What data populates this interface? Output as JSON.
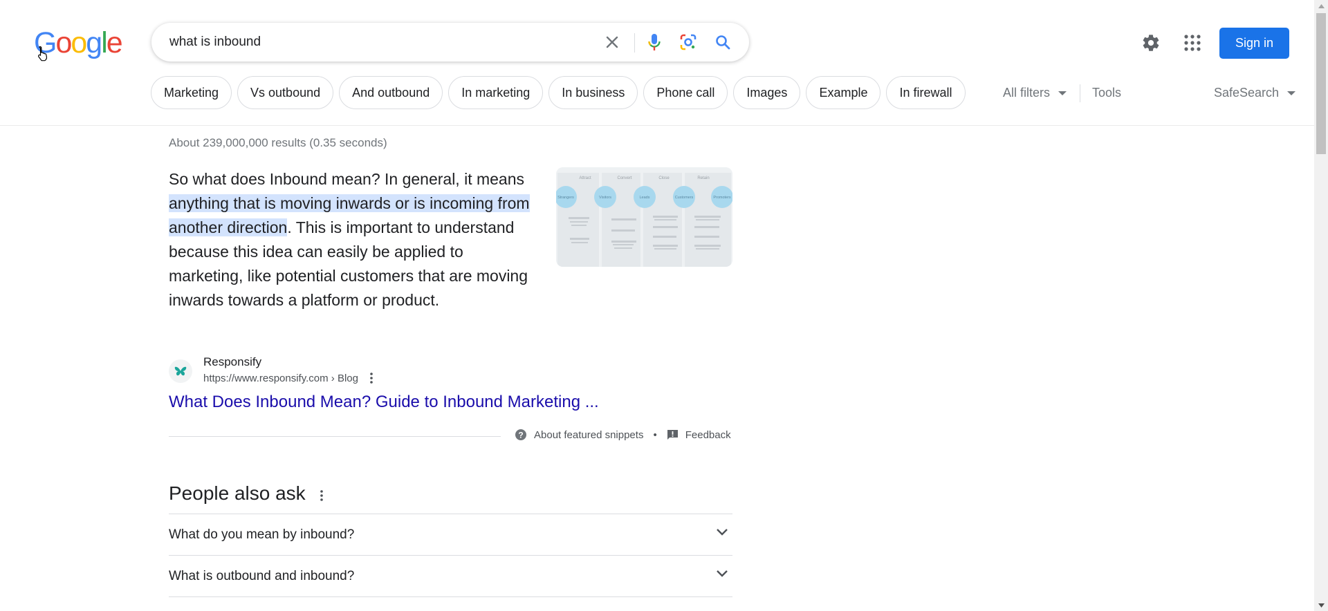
{
  "logo": {
    "letters": [
      "G",
      "o",
      "o",
      "g",
      "l",
      "e"
    ],
    "colors": [
      "#4285f4",
      "#ea4335",
      "#fbbc05",
      "#4285f4",
      "#34a853",
      "#ea4335"
    ]
  },
  "search": {
    "query": "what is inbound"
  },
  "header": {
    "signin_label": "Sign in"
  },
  "chips": [
    "Marketing",
    "Vs outbound",
    "And outbound",
    "In marketing",
    "In business",
    "Phone call",
    "Images",
    "Example",
    "In firewall"
  ],
  "filters": {
    "all_filters": "All filters",
    "tools": "Tools",
    "safesearch": "SafeSearch"
  },
  "results": {
    "stats": "About 239,000,000 results (0.35 seconds)"
  },
  "featured_snippet": {
    "text_before": "So what does Inbound mean? In general, it means ",
    "text_highlight": "anything that is moving inwards or is incoming from another direction",
    "text_after": ". This is important to understand because this idea can easily be applied to marketing, like potential customers that are moving inwards towards a platform or product.",
    "source_name": "Responsify",
    "source_url": "https://www.responsify.com › Blog",
    "title": "What Does Inbound Mean? Guide to Inbound Marketing ...",
    "footer_about": "About featured snippets",
    "footer_dot": "•",
    "footer_feedback": "Feedback",
    "diagram": {
      "stages": [
        "Attract",
        "Convert",
        "Close",
        "Retain"
      ],
      "nodes": [
        "Strangers",
        "Visitors",
        "Leads",
        "Customers",
        "Promoters"
      ]
    }
  },
  "people_also_ask": {
    "title": "People also ask",
    "questions": [
      "What do you mean by inbound?",
      "What is outbound and inbound?"
    ]
  },
  "colors": {
    "accent": "#1a73e8",
    "link": "#1a0dab",
    "highlight": "#d3e3fd"
  }
}
